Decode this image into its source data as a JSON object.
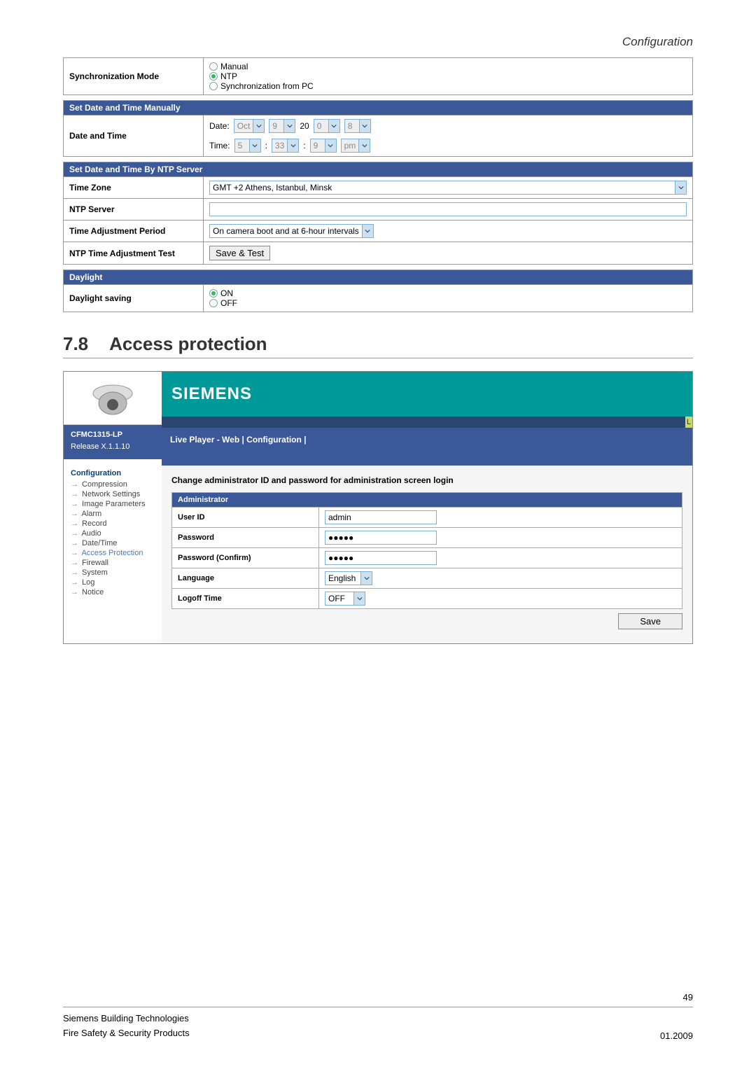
{
  "header": {
    "title": "Configuration"
  },
  "sync": {
    "label": "Synchronization Mode",
    "opts": {
      "manual": "Manual",
      "ntp": "NTP",
      "pc": "Synchronization from PC"
    }
  },
  "manual": {
    "hdr": "Set Date and Time Manually",
    "label": "Date and Time",
    "date_lbl": "Date:",
    "time_lbl": "Time:",
    "month": "Oct",
    "day": "9",
    "cent": "20",
    "ya": "0",
    "yb": "8",
    "hh": "5",
    "mm": "33",
    "ss": "9",
    "ampm": "pm"
  },
  "ntp": {
    "hdr": "Set Date and Time By NTP Server",
    "tz_lbl": "Time Zone",
    "tz_val": "GMT +2 Athens, Istanbul, Minsk",
    "srv_lbl": "NTP Server",
    "period_lbl": "Time Adjustment Period",
    "period_val": "On camera boot and at 6-hour intervals",
    "test_lbl": "NTP Time Adjustment Test",
    "test_btn": "Save & Test"
  },
  "dst": {
    "hdr": "Daylight",
    "lbl": "Daylight saving",
    "on": "ON",
    "off": "OFF"
  },
  "section": {
    "num": "7.8",
    "title": "Access protection"
  },
  "app": {
    "brand": "SIEMENS",
    "model": "CFMC1315-LP",
    "release": "Release X.1.1.10",
    "crumb": "Live Player - Web  |  Configuration  |",
    "nav_title": "Configuration",
    "nav": [
      "Compression",
      "Network Settings",
      "Image Parameters",
      "Alarm",
      "Record",
      "Audio",
      "Date/Time",
      "Access Protection",
      "Firewall",
      "System",
      "Log",
      "Notice"
    ],
    "nav_active_idx": 7,
    "desc": "Change administrator ID and password for administration screen login",
    "admin_hdr": "Administrator",
    "uid_lbl": "User ID",
    "uid_val": "admin",
    "pw_lbl": "Password",
    "pw_val": "●●●●●",
    "pwc_lbl": "Password (Confirm)",
    "pwc_val": "●●●●●",
    "lang_lbl": "Language",
    "lang_val": "English",
    "lo_lbl": "Logoff Time",
    "lo_val": "OFF",
    "save_btn": "Save"
  },
  "footer": {
    "l1": "Siemens Building Technologies",
    "l2": "Fire Safety & Security Products",
    "date": "01.2009",
    "page": "49"
  }
}
